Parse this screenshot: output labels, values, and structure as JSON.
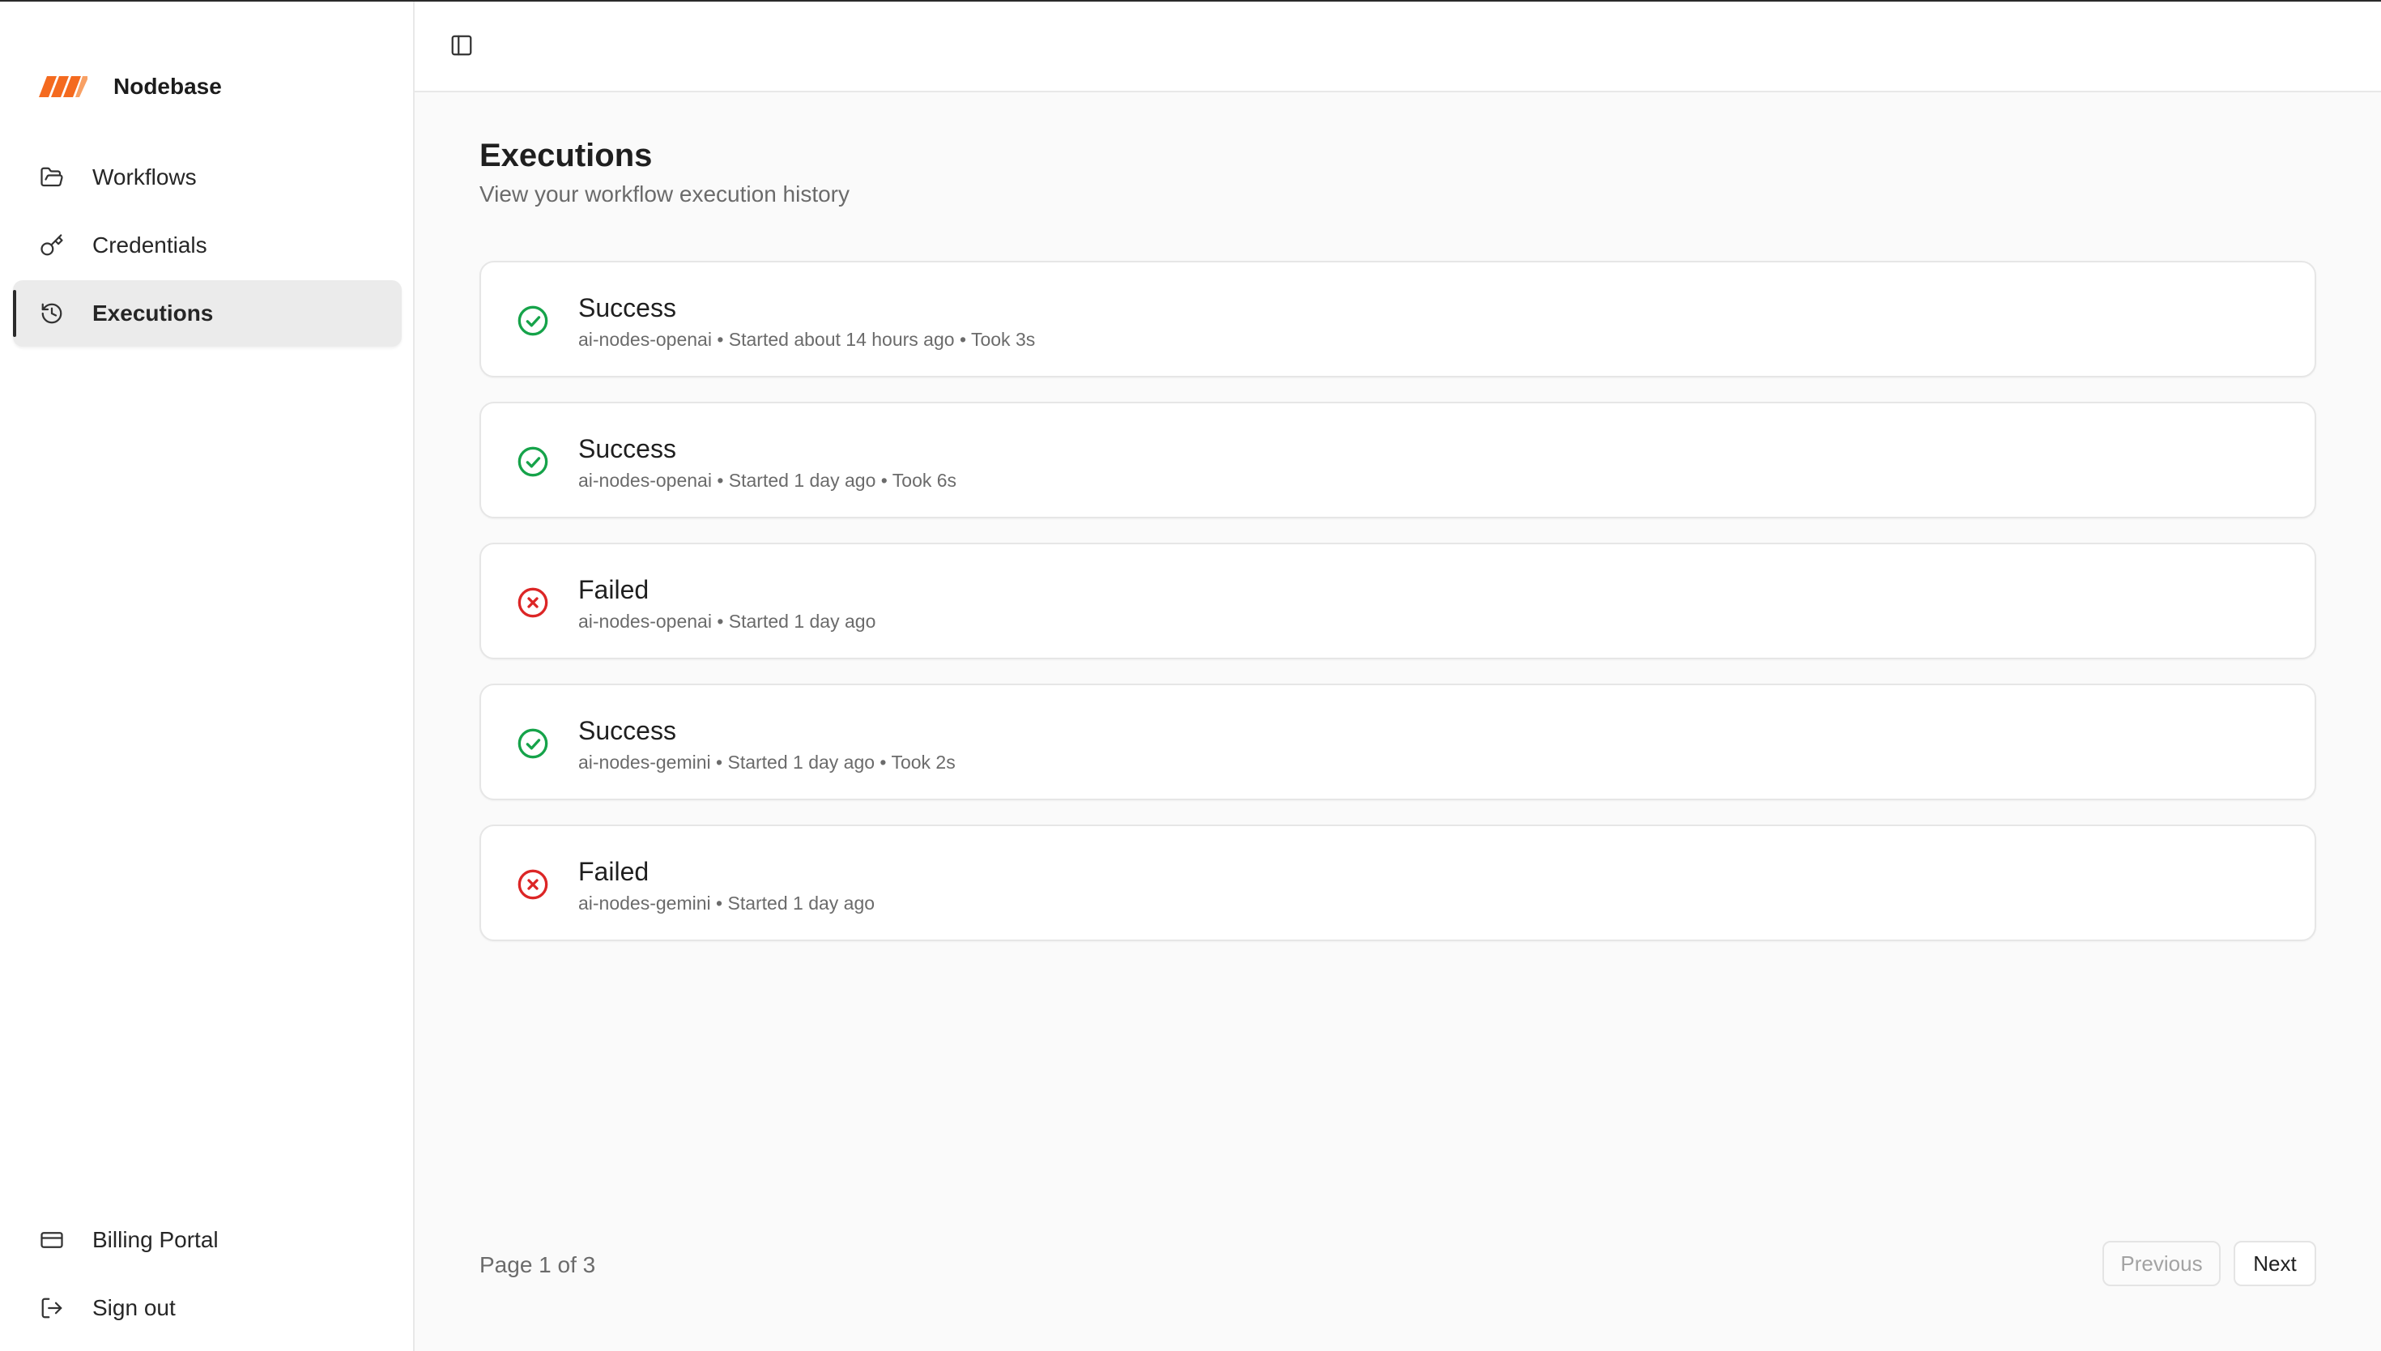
{
  "app": {
    "name": "Nodebase",
    "brand_color": "#F46A1F"
  },
  "sidebar": {
    "items": [
      {
        "label": "Workflows",
        "icon": "folder-open-icon",
        "active": false
      },
      {
        "label": "Credentials",
        "icon": "key-icon",
        "active": false
      },
      {
        "label": "Executions",
        "icon": "history-icon",
        "active": true
      }
    ],
    "bottom_items": [
      {
        "label": "Billing Portal",
        "icon": "credit-card-icon"
      },
      {
        "label": "Sign out",
        "icon": "log-out-icon"
      }
    ]
  },
  "header": {
    "toggle_icon": "panel-left-icon"
  },
  "page": {
    "title": "Executions",
    "subtitle": "View your workflow execution history"
  },
  "executions": [
    {
      "status": "Success",
      "meta": "ai-nodes-openai • Started about 14 hours ago • Took 3s"
    },
    {
      "status": "Success",
      "meta": "ai-nodes-openai • Started 1 day ago • Took 6s"
    },
    {
      "status": "Failed",
      "meta": "ai-nodes-openai • Started 1 day ago"
    },
    {
      "status": "Success",
      "meta": "ai-nodes-gemini • Started 1 day ago • Took 2s"
    },
    {
      "status": "Failed",
      "meta": "ai-nodes-gemini • Started 1 day ago"
    }
  ],
  "status_colors": {
    "success": "#16A34A",
    "failed": "#DC2626"
  },
  "pagination": {
    "text": "Page 1 of 3",
    "previous_label": "Previous",
    "next_label": "Next",
    "previous_disabled": true
  }
}
